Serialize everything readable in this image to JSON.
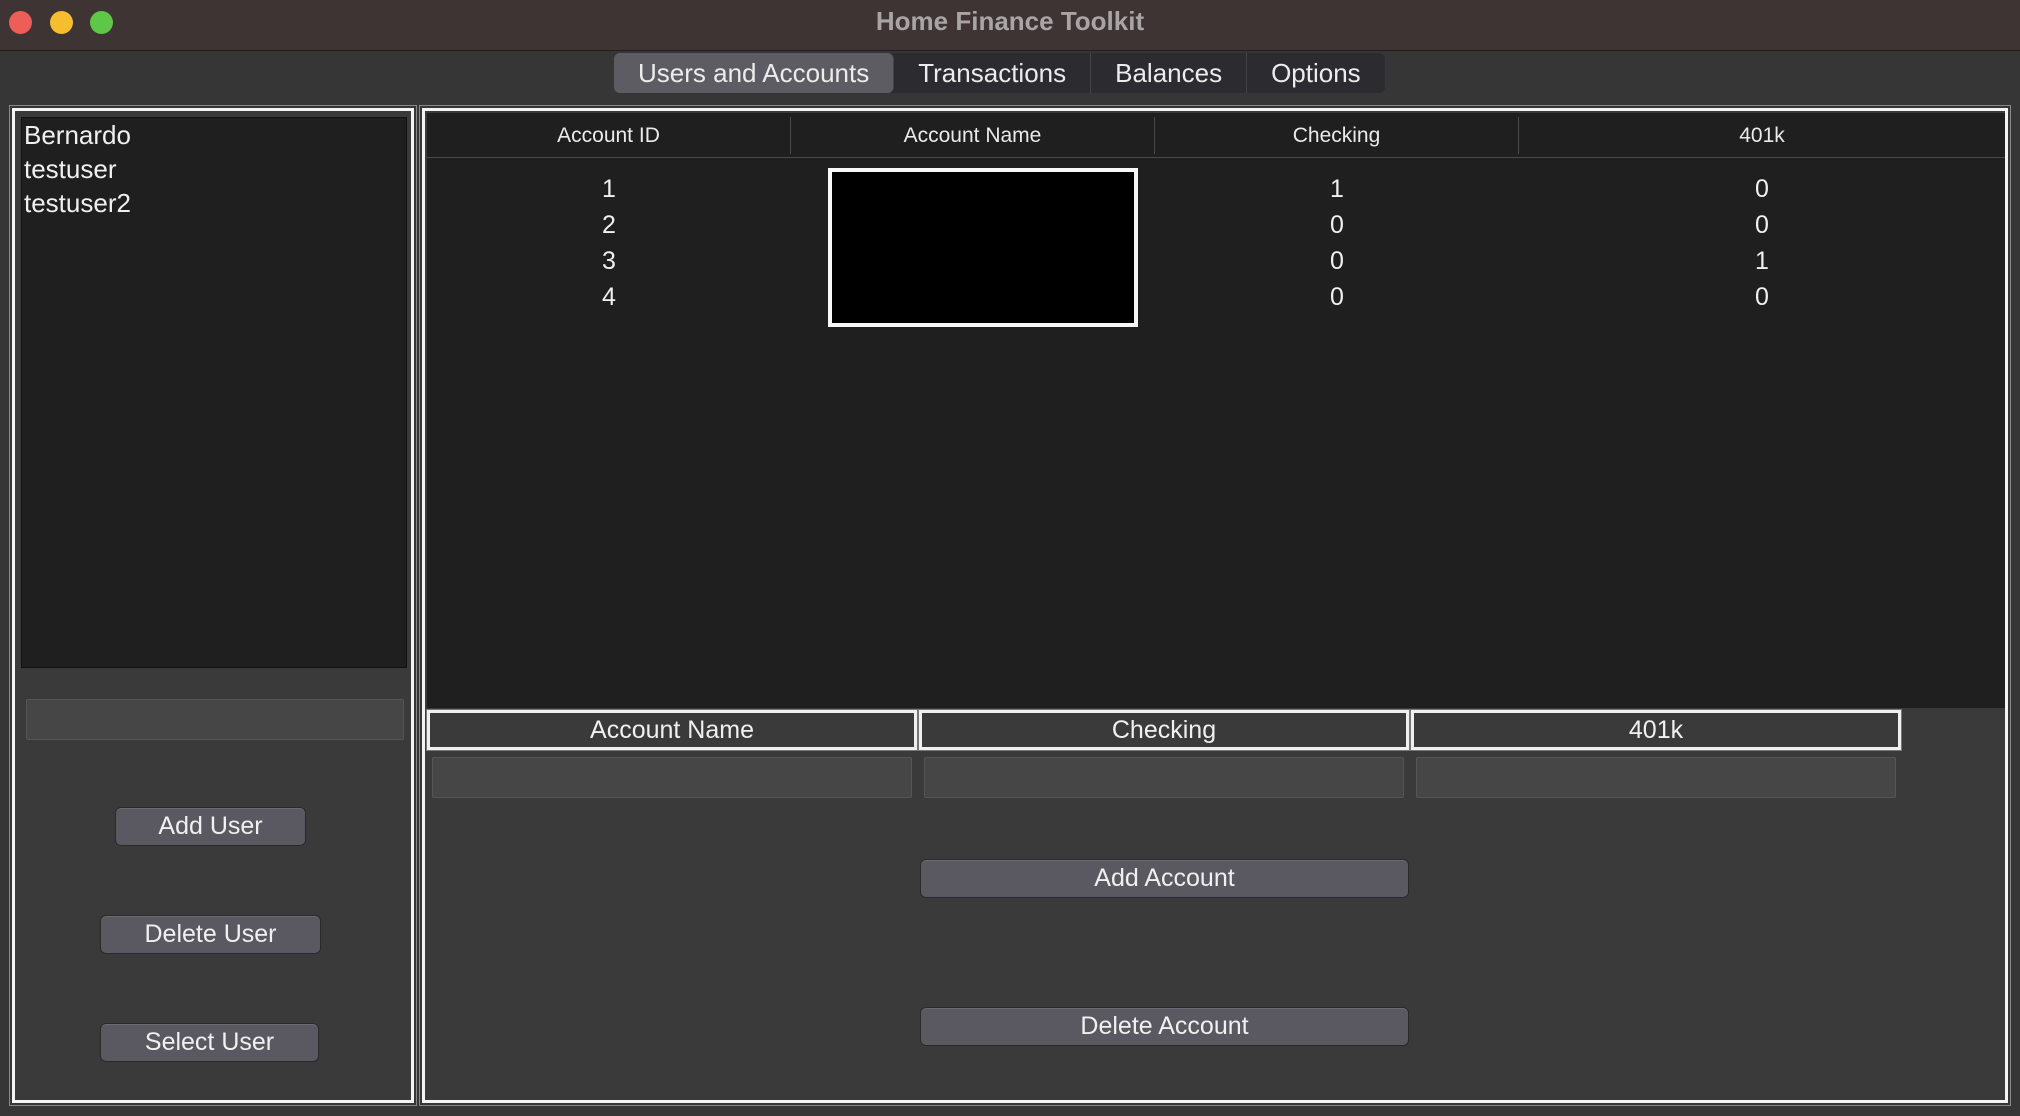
{
  "window": {
    "title": "Home Finance Toolkit"
  },
  "tabs": [
    {
      "label": "Users and Accounts",
      "active": true
    },
    {
      "label": "Transactions",
      "active": false
    },
    {
      "label": "Balances",
      "active": false
    },
    {
      "label": "Options",
      "active": false
    }
  ],
  "users": {
    "items": [
      "Bernardo",
      "testuser",
      "testuser2"
    ],
    "input_value": "",
    "add_label": "Add User",
    "delete_label": "Delete User",
    "select_label": "Select User"
  },
  "accounts_table": {
    "headers": [
      "Account ID",
      "Account Name",
      "Checking",
      "401k"
    ],
    "rows": [
      {
        "id": "1",
        "name": "",
        "checking": "1",
        "k401": "0"
      },
      {
        "id": "2",
        "name": "",
        "checking": "0",
        "k401": "0"
      },
      {
        "id": "3",
        "name": "",
        "checking": "0",
        "k401": "1"
      },
      {
        "id": "4",
        "name": "",
        "checking": "0",
        "k401": "0"
      }
    ]
  },
  "account_form": {
    "labels": {
      "name": "Account Name",
      "checking": "Checking",
      "k401": "401k"
    },
    "values": {
      "name": "",
      "checking": "",
      "k401": ""
    },
    "add_label": "Add Account",
    "delete_label": "Delete Account"
  },
  "colors": {
    "titlebar": "#3d3433",
    "window_bg": "#363636",
    "grid_bg": "#1f1f1f",
    "button_bg": "#5a5961",
    "active_tab": "#5d5c63",
    "close": "#ee5e58",
    "minimize": "#f5bd2f",
    "maximize": "#5fc748"
  }
}
